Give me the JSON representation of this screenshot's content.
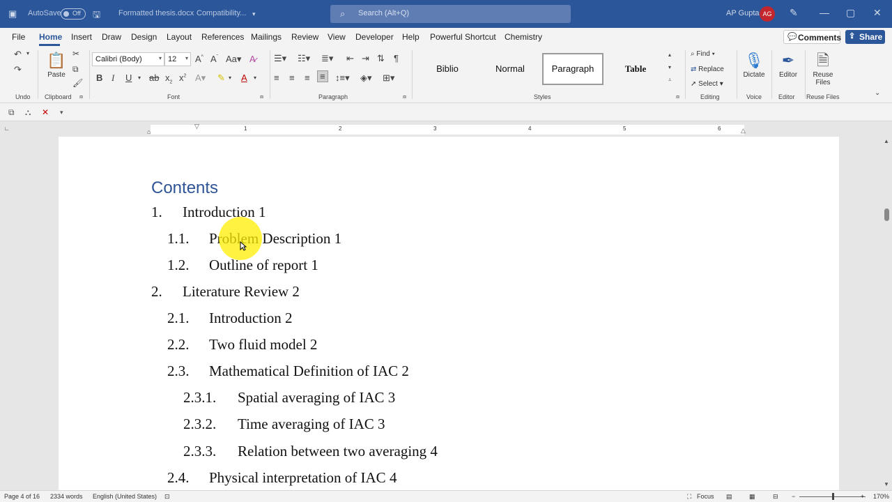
{
  "titlebar": {
    "autosave_label": "AutoSave",
    "autosave_state": "Off",
    "doc_name": "Formatted thesis.docx",
    "mode": "Compatibility...",
    "search_placeholder": "Search (Alt+Q)",
    "user_name": "AP Gupta",
    "user_initials": "AG"
  },
  "menu": {
    "tabs": [
      "File",
      "Home",
      "Insert",
      "Draw",
      "Design",
      "Layout",
      "References",
      "Mailings",
      "Review",
      "View",
      "Developer",
      "Help",
      "Powerful Shortcut",
      "Chemistry"
    ],
    "active": "Home",
    "comments_label": "Comments",
    "share_label": "Share"
  },
  "ribbon": {
    "undo_label": "Undo",
    "paste_label": "Paste",
    "clipboard_label": "Clipboard",
    "font_name": "Calibri (Body)",
    "font_size": "12",
    "font_label": "Font",
    "paragraph_label": "Paragraph",
    "styles": [
      "Biblio",
      "Normal",
      "Paragraph",
      "Table"
    ],
    "selected_style": "Paragraph",
    "styles_label": "Styles",
    "find_label": "Find",
    "replace_label": "Replace",
    "select_label": "Select",
    "editing_label": "Editing",
    "dictate_label": "Dictate",
    "voice_label": "Voice",
    "editor_label": "Editor",
    "editor_group_label": "Editor",
    "reuse_label": "Reuse Files",
    "reuse_group_label": "Reuse Files"
  },
  "ruler": {
    "numbers": [
      "1",
      "2",
      "3",
      "4",
      "5",
      "6"
    ]
  },
  "document": {
    "heading": "Contents",
    "toc": [
      {
        "num": "1.",
        "text": "Introduction 1",
        "level": 1
      },
      {
        "num": "1.1.",
        "text": "Problem Description 1",
        "level": 2
      },
      {
        "num": "1.2.",
        "text": "Outline of report 1",
        "level": 2
      },
      {
        "num": "2.",
        "text": "Literature Review 2",
        "level": 1
      },
      {
        "num": "2.1.",
        "text": "Introduction 2",
        "level": 2
      },
      {
        "num": "2.2.",
        "text": "Two fluid model 2",
        "level": 2
      },
      {
        "num": "2.3.",
        "text": "Mathematical Definition of IAC 2",
        "level": 2
      },
      {
        "num": "2.3.1.",
        "text": "Spatial averaging of IAC 3",
        "level": 3
      },
      {
        "num": "2.3.2.",
        "text": "Time averaging of IAC 3",
        "level": 3
      },
      {
        "num": "2.3.3.",
        "text": "Relation between two averaging 4",
        "level": 3
      },
      {
        "num": "2.4.",
        "text": "Physical interpretation of IAC 4",
        "level": 2
      }
    ]
  },
  "status": {
    "page": "Page 4 of 16",
    "words": "2334 words",
    "language": "English (United States)",
    "focus_label": "Focus",
    "zoom": "170%"
  }
}
